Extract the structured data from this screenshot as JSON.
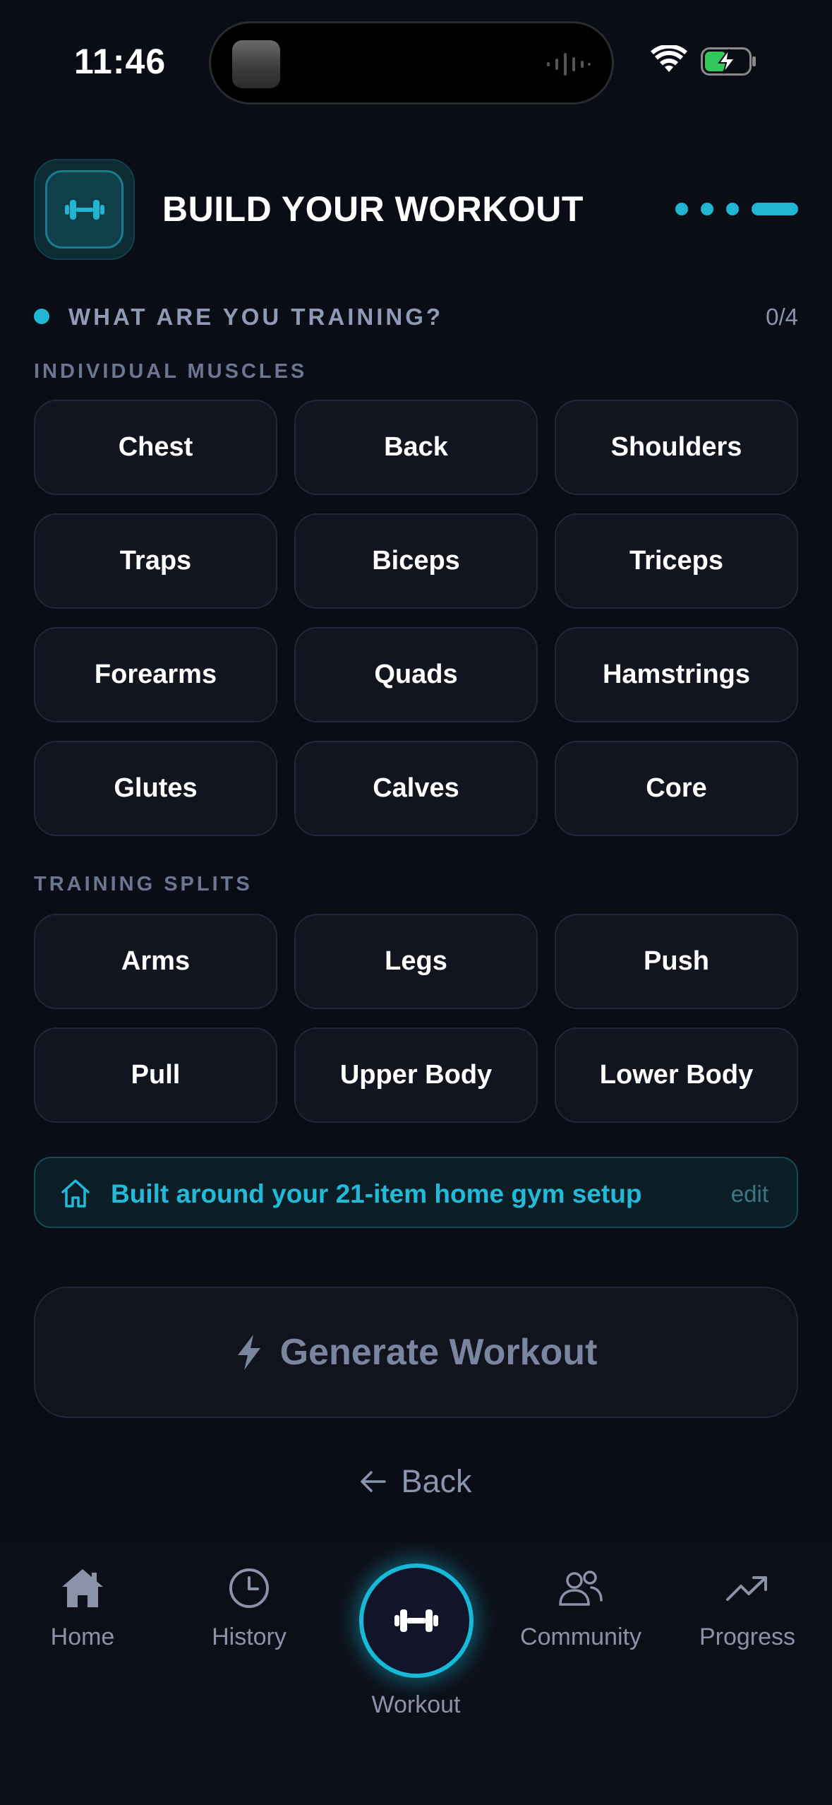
{
  "status_bar": {
    "time": "11:46"
  },
  "header": {
    "title": "BUILD YOUR WORKOUT",
    "step_total": 4,
    "step_current": 4
  },
  "section": {
    "label": "WHAT ARE YOU TRAINING?",
    "count": "0/4"
  },
  "muscles": {
    "label": "INDIVIDUAL MUSCLES",
    "items": [
      "Chest",
      "Back",
      "Shoulders",
      "Traps",
      "Biceps",
      "Triceps",
      "Forearms",
      "Quads",
      "Hamstrings",
      "Glutes",
      "Calves",
      "Core"
    ]
  },
  "splits": {
    "label": "TRAINING SPLITS",
    "items": [
      "Arms",
      "Legs",
      "Push",
      "Pull",
      "Upper Body",
      "Lower Body"
    ]
  },
  "home_note": {
    "text": "Built around your 21-item home gym setup",
    "edit_label": "edit"
  },
  "generate": {
    "label": "Generate Workout"
  },
  "back": {
    "label": "Back"
  },
  "tabbar": {
    "home": "Home",
    "history": "History",
    "workout": "Workout",
    "community": "Community",
    "progress": "Progress"
  },
  "colors": {
    "accent": "#1fb5d3",
    "background": "#0b0d16",
    "chip": "#12141f"
  }
}
